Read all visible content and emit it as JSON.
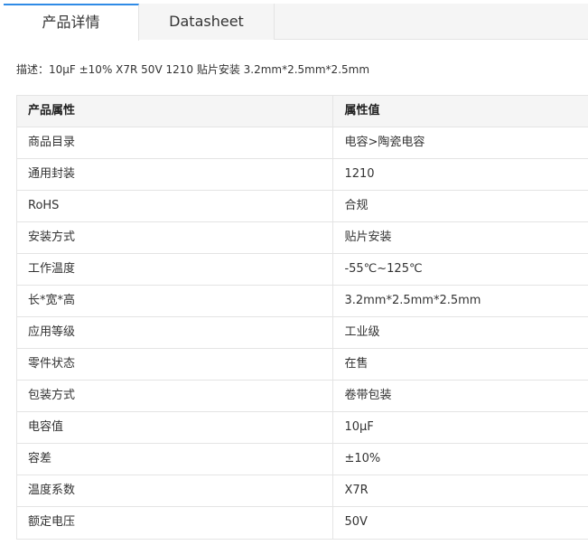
{
  "tabs": [
    {
      "label": "产品详情",
      "active": true
    },
    {
      "label": "Datasheet",
      "active": false
    }
  ],
  "description": "描述：10μF ±10% X7R 50V 1210 贴片安装 3.2mm*2.5mm*2.5mm",
  "table": {
    "headers": [
      "产品属性",
      "属性值"
    ],
    "rows": [
      [
        "商品目录",
        "电容>陶瓷电容"
      ],
      [
        "通用封装",
        "1210"
      ],
      [
        "RoHS",
        "合规"
      ],
      [
        "安装方式",
        "贴片安装"
      ],
      [
        "工作温度",
        "-55℃~125℃"
      ],
      [
        "长*宽*高",
        "3.2mm*2.5mm*2.5mm"
      ],
      [
        "应用等级",
        "工业级"
      ],
      [
        "零件状态",
        "在售"
      ],
      [
        "包装方式",
        "卷带包装"
      ],
      [
        "电容值",
        "10μF"
      ],
      [
        "容差",
        "±10%"
      ],
      [
        "温度系数",
        "X7R"
      ],
      [
        "额定电压",
        "50V"
      ]
    ]
  },
  "colors": {
    "accent": "#2f8be6",
    "border": "#e4e4e4",
    "header_bg": "#f5f5f5"
  }
}
